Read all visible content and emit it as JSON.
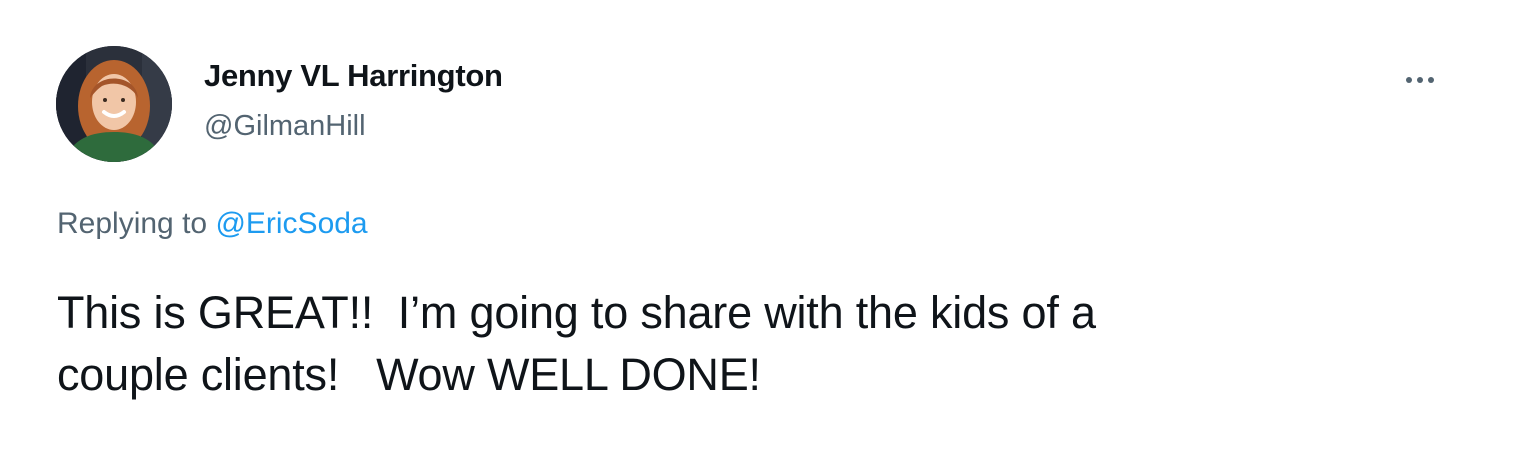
{
  "tweet": {
    "author": {
      "display_name": "Jenny VL Harrington",
      "handle": "@GilmanHill",
      "avatar_icon": "profile-photo"
    },
    "more_icon": "ellipsis-icon",
    "reply_context": {
      "prefix": "Replying to",
      "mention": "@EricSoda"
    },
    "text": "This is GREAT!!  I’m going to share with the kids of a\ncouple clients!   Wow WELL DONE!"
  },
  "colors": {
    "text_primary": "#0f1419",
    "text_secondary": "#536471",
    "link": "#1d9bf0",
    "background": "#ffffff"
  }
}
